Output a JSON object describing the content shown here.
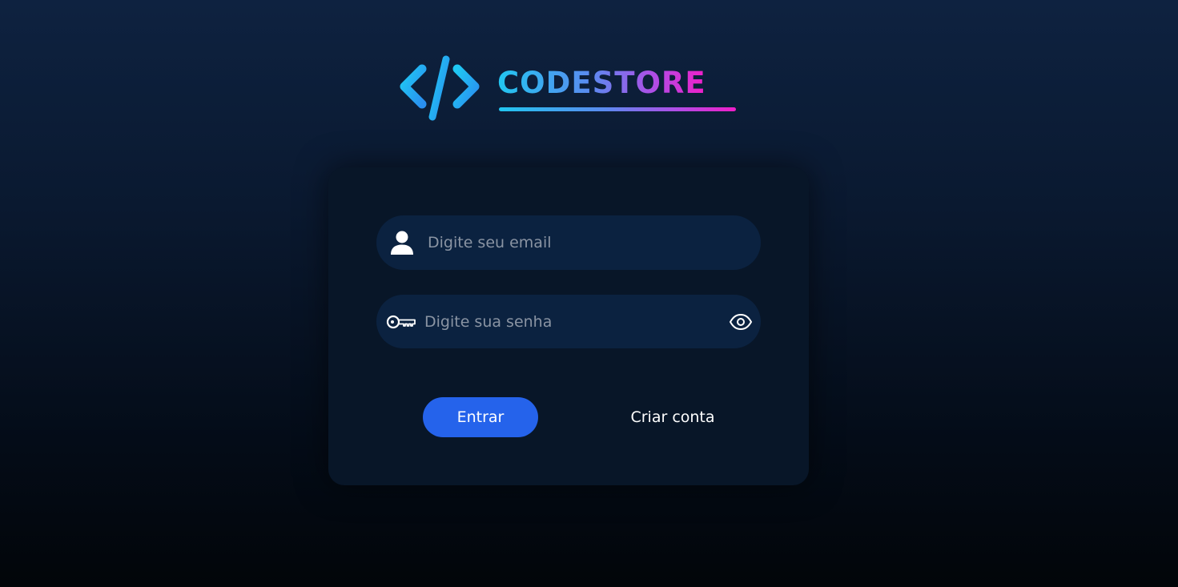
{
  "brand": {
    "name": "CODESTORE",
    "logo_icon": "code-brackets-icon",
    "gradient_start": "#21c6f0",
    "gradient_end": "#f01ec8"
  },
  "login_form": {
    "email": {
      "placeholder": "Digite seu email",
      "value": "",
      "icon": "user-icon"
    },
    "password": {
      "placeholder": "Digite sua senha",
      "value": "",
      "icon": "key-icon",
      "toggle_icon": "eye-icon"
    },
    "submit_label": "Entrar",
    "create_account_label": "Criar conta"
  },
  "colors": {
    "primary_button": "#2563eb",
    "card_background": "#081628",
    "input_background": "#0b2240"
  }
}
